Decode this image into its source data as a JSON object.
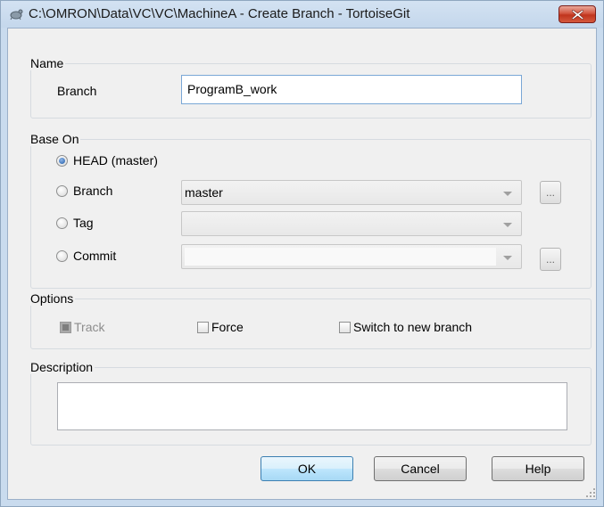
{
  "window": {
    "title": "C:\\OMRON\\Data\\VC\\VC\\MachineA - Create Branch - TortoiseGit",
    "icon": "tortoisegit-icon",
    "close_icon": "close-icon"
  },
  "name_group": {
    "title": "Name",
    "branch_label": "Branch",
    "branch_value": "ProgramB_work"
  },
  "base_on": {
    "title": "Base On",
    "head_label": "HEAD (master)",
    "head_checked": true,
    "branch_label": "Branch",
    "branch_value": "master",
    "tag_label": "Tag",
    "tag_value": "",
    "commit_label": "Commit",
    "commit_value": "",
    "browse_label": "..."
  },
  "options": {
    "title": "Options",
    "track_label": "Track",
    "force_label": "Force",
    "switch_label": "Switch to new branch"
  },
  "description": {
    "title": "Description",
    "value": ""
  },
  "buttons": {
    "ok": "OK",
    "cancel": "Cancel",
    "help": "Help"
  },
  "colors": {
    "titlebar": "#c9dbee",
    "close_button": "#c94a33",
    "client": "#f0f0f0",
    "default_button": "#bee6fd"
  }
}
